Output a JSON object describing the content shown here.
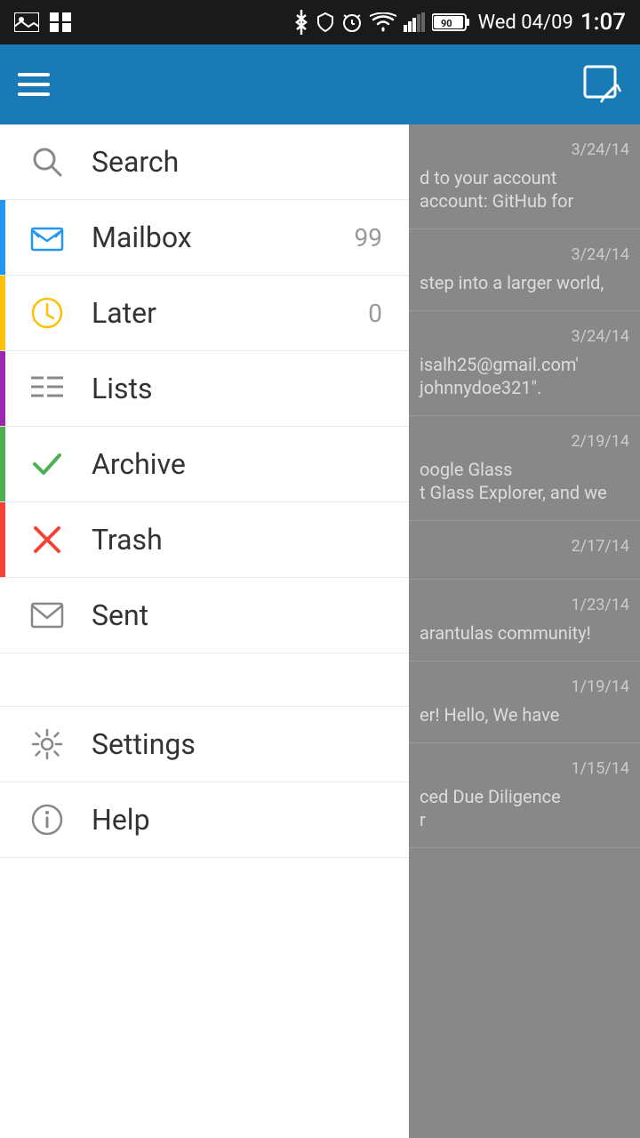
{
  "statusBar": {
    "time": "1:07",
    "date": "Wed 04/09",
    "batteryLevel": "90"
  },
  "toolbar": {
    "menuLabel": "Menu",
    "composeLabel": "Compose"
  },
  "drawer": {
    "items": [
      {
        "id": "search",
        "label": "Search",
        "icon": "search-icon",
        "badge": "",
        "accentClass": ""
      },
      {
        "id": "mailbox",
        "label": "Mailbox",
        "icon": "mailbox-icon",
        "badge": "99",
        "accentClass": "mailbox"
      },
      {
        "id": "later",
        "label": "Later",
        "icon": "clock-icon",
        "badge": "0",
        "accentClass": "later"
      },
      {
        "id": "lists",
        "label": "Lists",
        "icon": "list-icon",
        "badge": "",
        "accentClass": "lists"
      },
      {
        "id": "archive",
        "label": "Archive",
        "icon": "check-icon",
        "badge": "",
        "accentClass": "archive"
      },
      {
        "id": "trash",
        "label": "Trash",
        "icon": "x-icon",
        "badge": "",
        "accentClass": "trash"
      },
      {
        "id": "sent",
        "label": "Sent",
        "icon": "envelope-icon",
        "badge": "",
        "accentClass": ""
      }
    ],
    "bottomItems": [
      {
        "id": "settings",
        "label": "Settings",
        "icon": "settings-icon",
        "badge": ""
      },
      {
        "id": "help",
        "label": "Help",
        "icon": "info-icon",
        "badge": ""
      }
    ]
  },
  "emailList": {
    "items": [
      {
        "date": "3/24/14",
        "preview": "d to your account\naccount: GitHub for"
      },
      {
        "date": "3/24/14",
        "preview": "step into a larger world,"
      },
      {
        "date": "3/24/14",
        "preview": "isalh25@gmail.com'\njohnnydoe321\"."
      },
      {
        "date": "2/19/14",
        "preview": "oogle Glass\nt Glass Explorer, and we"
      },
      {
        "date": "2/17/14",
        "preview": ""
      },
      {
        "date": "1/23/14",
        "preview": "arantulas community!"
      },
      {
        "date": "1/19/14",
        "preview": "er! Hello, We have"
      },
      {
        "date": "1/15/14",
        "preview": "ced Due Diligence\nr"
      }
    ]
  }
}
